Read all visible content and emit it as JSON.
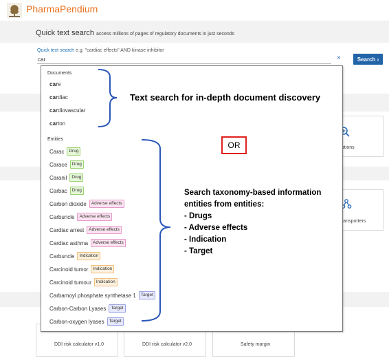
{
  "header": {
    "brand": "PharmaPendium"
  },
  "quick_search": {
    "title": "Quick text search",
    "subtitle": "access millions of pages of regulatory documents in just seconds",
    "hint_link": "Quick text search",
    "hint_text": "e.g. \"cardiac effects\" AND kinase inhibitor",
    "query": "car",
    "search_label": "Search",
    "search_arrow": "›",
    "clear_symbol": "×"
  },
  "dropdown": {
    "documents_title": "Documents",
    "documents": [
      {
        "bold": "car",
        "rest": "e"
      },
      {
        "bold": "car",
        "rest": "diac"
      },
      {
        "bold": "car",
        "rest": "diovascular"
      },
      {
        "bold": "car",
        "rest": "ton"
      }
    ],
    "entities_title": "Entities",
    "entities": [
      {
        "name": "Carac",
        "tag": "Drug",
        "kind": "drug"
      },
      {
        "name": "Carace",
        "tag": "Drug",
        "kind": "drug"
      },
      {
        "name": "Caranil",
        "tag": "Drug",
        "kind": "drug"
      },
      {
        "name": "Carbac",
        "tag": "Drug",
        "kind": "drug"
      },
      {
        "name": "Carbon dioxide",
        "tag": "Adverse effects",
        "kind": "ae"
      },
      {
        "name": "Carbuncle",
        "tag": "Adverse effects",
        "kind": "ae"
      },
      {
        "name": "Cardiac arrest",
        "tag": "Adverse effects",
        "kind": "ae"
      },
      {
        "name": "Cardiac asthma",
        "tag": "Adverse effects",
        "kind": "ae"
      },
      {
        "name": "Carbuncle",
        "tag": "Indication",
        "kind": "ind"
      },
      {
        "name": "Carcinoid tumor",
        "tag": "Indication",
        "kind": "ind"
      },
      {
        "name": "Carcinoid tumour",
        "tag": "Indication",
        "kind": "ind"
      },
      {
        "name": "Carbamoyl phosphate synthetase 1",
        "tag": "Target",
        "kind": "tgt"
      },
      {
        "name": "Carbon-Carbon Lyases",
        "tag": "Target",
        "kind": "tgt"
      },
      {
        "name": "Carbon-oxygen lyases",
        "tag": "Target",
        "kind": "tgt"
      }
    ]
  },
  "cards": {
    "ddi_v1": "DDI risk calculator v1.0",
    "ddi_v2": "DDI risk calculator v2.0",
    "safety_margin": "Safety margin",
    "right_card_1": "ations",
    "right_card_2": "z. & transporters"
  },
  "annotations": {
    "text_search": "Text search for in-depth document discovery",
    "or": "OR",
    "taxonomy_lines": [
      "Search taxonomy-based information",
      "entities from entities:",
      "- Drugs",
      "- Adverse effects",
      "- Indication",
      "- Target"
    ]
  },
  "colors": {
    "brand": "#e9711c",
    "link": "#1a6fb3",
    "search_button": "#2264a8",
    "bracket": "#2a56b8",
    "or_border": "#e0201a"
  },
  "icons": [
    "elsevier-tree-logo",
    "close-icon",
    "chevron-right-icon",
    "search-plus-icon",
    "molecule-icon"
  ]
}
